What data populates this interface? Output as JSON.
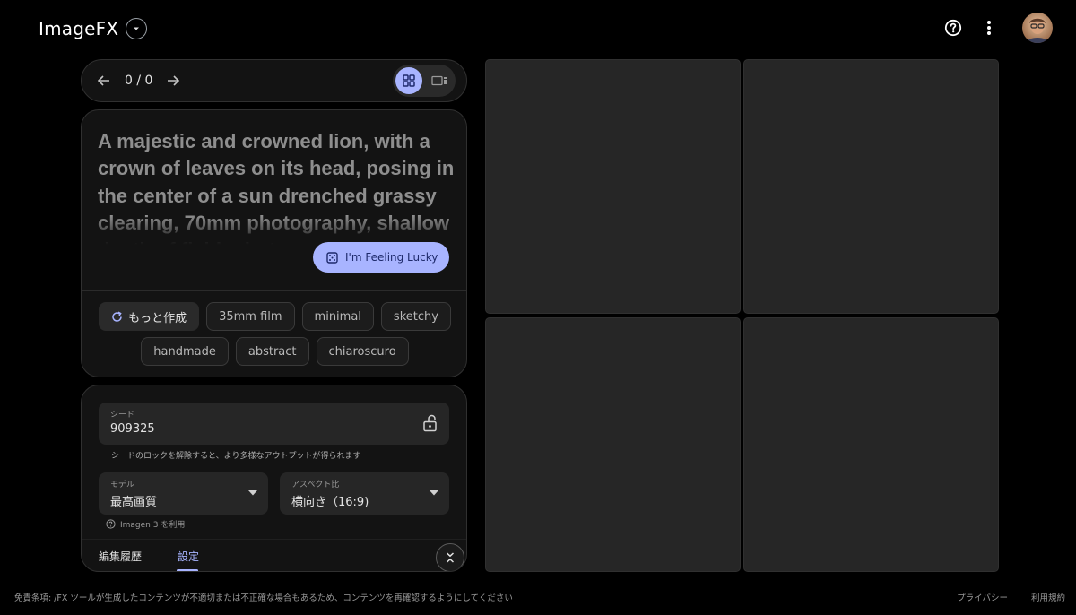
{
  "header": {
    "app_title": "ImageFX",
    "icons": {
      "dropdown": "chevron-down-icon",
      "help": "help-circle-icon",
      "menu": "more-vert-icon",
      "avatar": "user-avatar"
    }
  },
  "pager": {
    "count": "0 / 0",
    "prev_icon": "arrow-left-icon",
    "next_icon": "arrow-right-icon",
    "views": [
      {
        "name": "grid-view-icon",
        "active": true
      },
      {
        "name": "single-view-icon",
        "active": false
      }
    ]
  },
  "prompt": {
    "text": "A majestic and crowned lion, with a crown of leaves on its head, posing in the center of a sun drenched grassy clearing, 70mm photography, shallow depth of field, photographic, hyper-realistic",
    "lucky_label": "I'm Feeling Lucky",
    "more_label": "もっと作成",
    "chips_row1": [
      "35mm film",
      "minimal",
      "sketchy"
    ],
    "chips_row2": [
      "handmade",
      "abstract",
      "chiaroscuro"
    ]
  },
  "settings": {
    "seed_label": "シード",
    "seed_value": "909325",
    "seed_help": "シードのロックを解除すると、より多様なアウトプットが得られます",
    "model_label": "モデル",
    "model_value": "最高画質",
    "aspect_label": "アスペクト比",
    "aspect_value": "横向き（16:9)",
    "model_note": "Imagen 3 を利用",
    "tabs": {
      "history": "編集履歴",
      "settings": "設定"
    },
    "active_tab": "settings"
  },
  "images": {
    "tile_count": 4
  },
  "footer": {
    "disclaimer": "免責条項: /FX ツールが生成したコンテンツが不適切または不正確な場合もあるため、コンテンツを再確認するようにしてください",
    "privacy": "プライバシー",
    "terms": "利用規約"
  },
  "colors": {
    "accent": "#a8b4ff",
    "background": "#000000",
    "panel": "#131313",
    "tile": "#262626"
  }
}
